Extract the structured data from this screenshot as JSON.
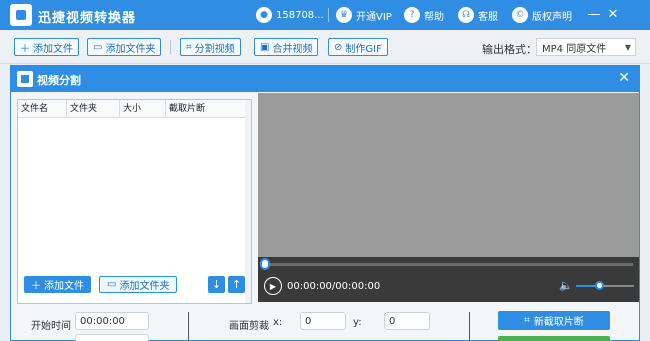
{
  "app": {
    "title": "迅捷视频转换器"
  },
  "titlebar": {
    "user": "158708...",
    "vip": "开通VIP",
    "help": "帮助",
    "service": "客服",
    "copyright": "版权声明"
  },
  "toolbar": {
    "add_file": "添加文件",
    "add_folder": "添加文件夹",
    "split_video": "分割视频",
    "merge_video": "合并视频",
    "make_gif": "制作GIF",
    "output_format_label": "输出格式：",
    "output_format_value": "MP4  同原文件"
  },
  "dialog": {
    "title": "视频分割",
    "columns": [
      "文件名",
      "文件夹",
      "大小",
      "截取片断"
    ],
    "add_file": "添加文件",
    "add_folder": "添加文件夹",
    "timecode": "00:00:00/00:00:00",
    "volume_level": 0.4,
    "start_time_label": "开始时间",
    "start_time_value": "00:00:00",
    "crop_label": "画面剪裁",
    "x_label": "x:",
    "x_value": "0",
    "y_label": "y:",
    "y_value": "0",
    "new_clip": "新截取片断"
  }
}
